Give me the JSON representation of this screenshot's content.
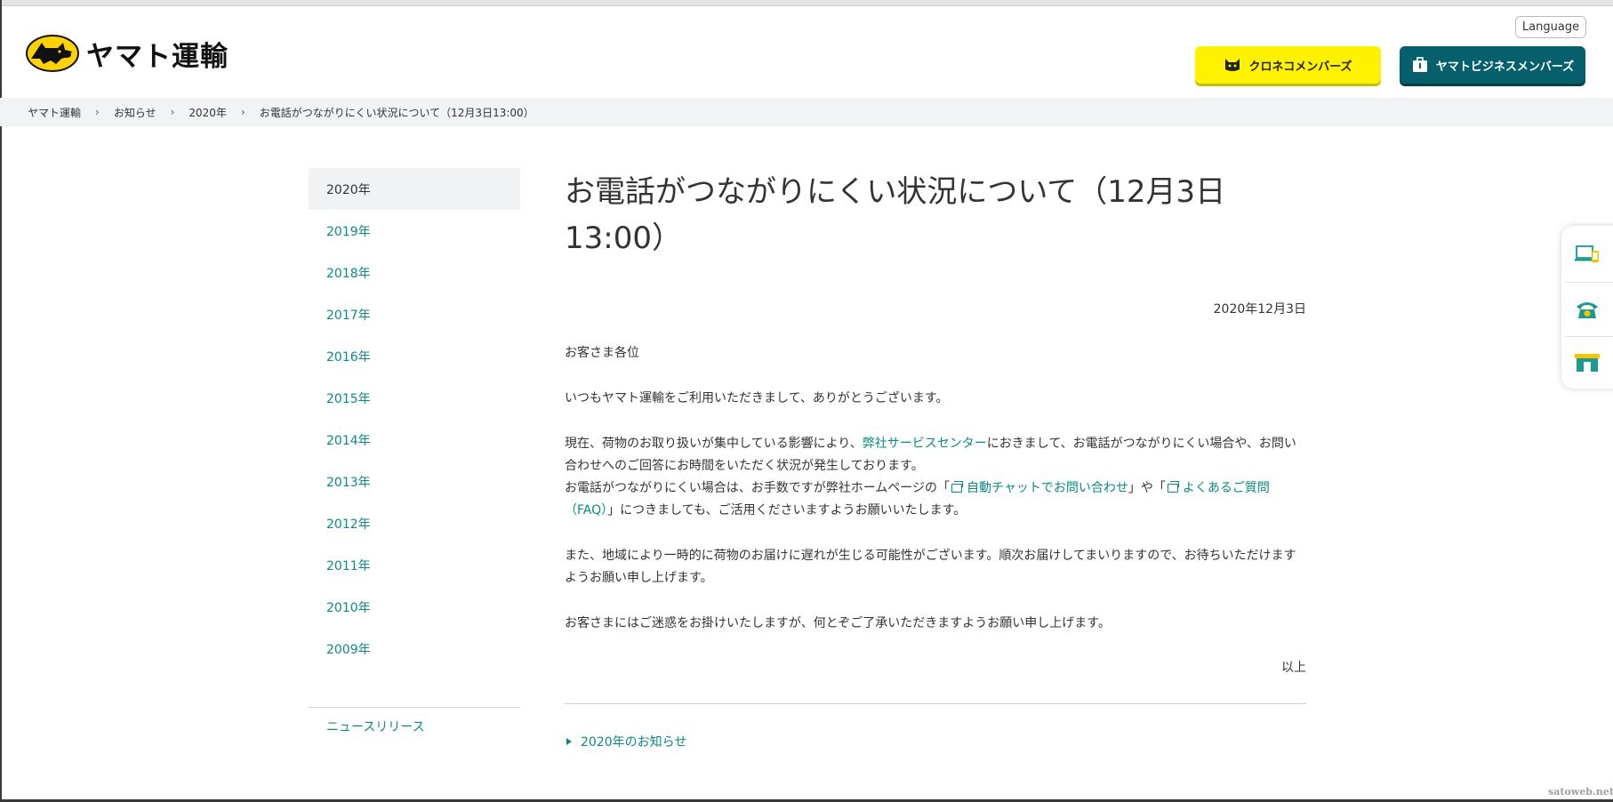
{
  "header": {
    "logo_text": "ヤマト運輸",
    "language_label": "Language",
    "kuroneko_label": "クロネコメンバーズ",
    "business_label": "ヤマトビジネスメンバーズ"
  },
  "breadcrumb": [
    "ヤマト運輸",
    "お知らせ",
    "2020年",
    "お電話がつながりにくい状況について（12月3日13:00）"
  ],
  "sidebar": {
    "years": [
      {
        "label": "2020年",
        "active": true
      },
      {
        "label": "2019年",
        "active": false
      },
      {
        "label": "2018年",
        "active": false
      },
      {
        "label": "2017年",
        "active": false
      },
      {
        "label": "2016年",
        "active": false
      },
      {
        "label": "2015年",
        "active": false
      },
      {
        "label": "2014年",
        "active": false
      },
      {
        "label": "2013年",
        "active": false
      },
      {
        "label": "2012年",
        "active": false
      },
      {
        "label": "2011年",
        "active": false
      },
      {
        "label": "2010年",
        "active": false
      },
      {
        "label": "2009年",
        "active": false
      }
    ],
    "news_release": "ニュースリリース"
  },
  "article": {
    "title": "お電話がつながりにくい状況について（12月3日13:00）",
    "date": "2020年12月3日",
    "salutation": "お客さま各位",
    "greeting": "いつもヤマト運輸をご利用いただきまして、ありがとうございます。",
    "p3_before": "現在、荷物のお取り扱いが集中している影響により、",
    "p3_link": "弊社サービスセンター",
    "p3_after": "におきまして、お電話がつながりにくい場合や、お問い合わせへのご回答にお時間をいただく状況が発生しております。",
    "p3b_before": "お電話がつながりにくい場合は、お手数ですが弊社ホームページの「",
    "p3b_link1": "自動チャットでお問い合わせ",
    "p3b_mid": "」や「",
    "p3b_link2": "よくあるご質問（FAQ）",
    "p3b_after": "」につきましても、ご活用くださいますようお願いいたします。",
    "p4": "また、地域により一時的に荷物のお届けに遅れが生じる可能性がございます。順次お届けしてまいりますので、お待ちいただけますようお願い申し上げます。",
    "p5": "お客さまにはご迷惑をお掛けいたしますが、何とぞご了承いただきますようお願い申し上げます。",
    "closing": "以上",
    "back_link": "2020年のお知らせ"
  },
  "floater": {
    "icons": [
      "web-service-icon",
      "phone-icon",
      "store-icon"
    ]
  },
  "watermark": "satoweb.net",
  "colors": {
    "accent_teal": "#0b8a80",
    "kuroneko_yellow": "#fff200",
    "business_teal": "#06606c"
  }
}
